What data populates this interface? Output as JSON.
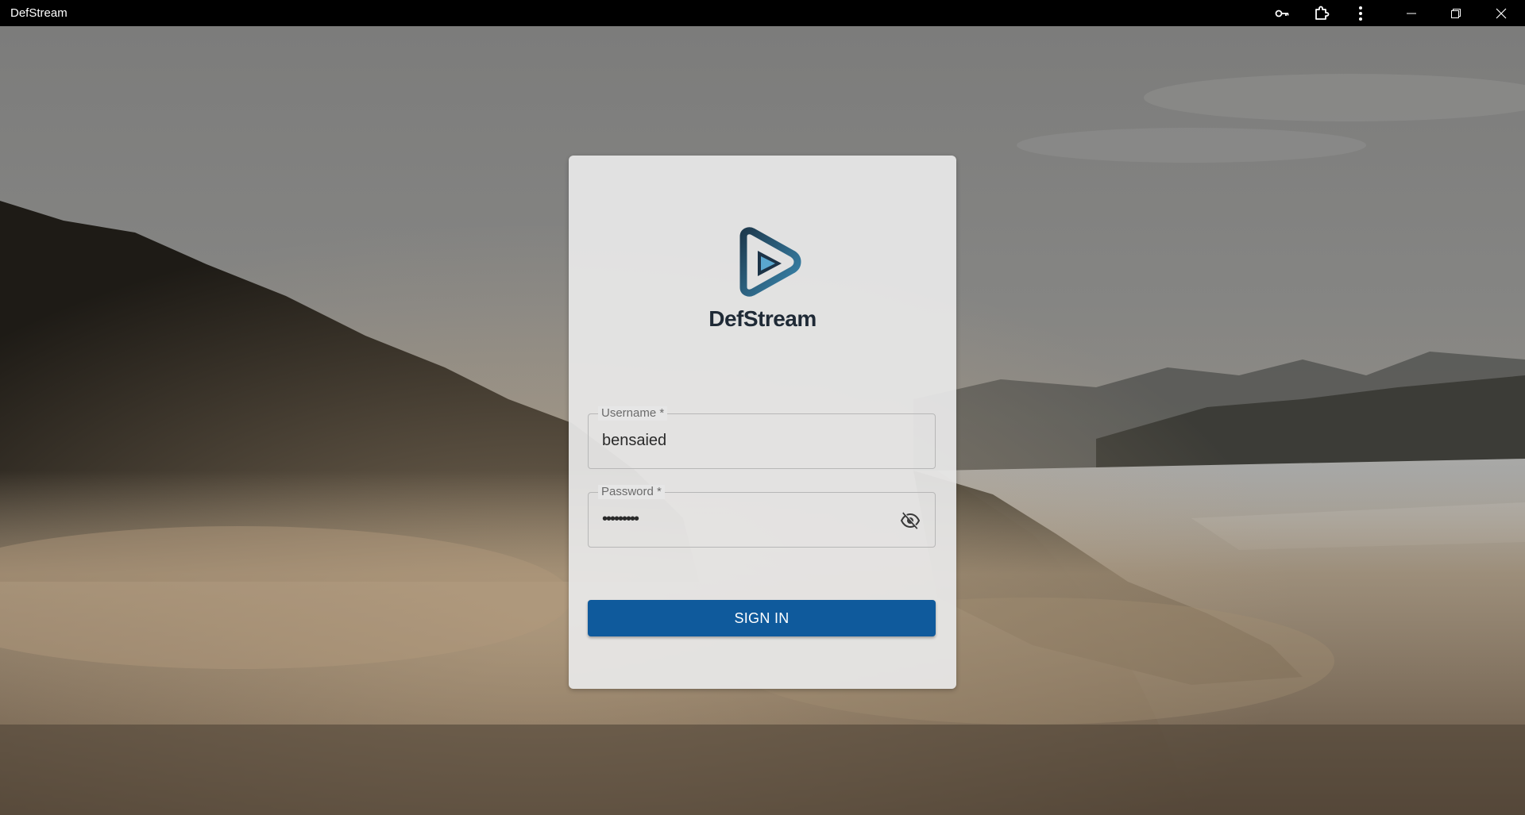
{
  "window": {
    "title": "DefStream",
    "controls": {
      "key_icon": "key-icon",
      "extension_icon": "puzzle-piece-icon",
      "menu_icon": "more-vertical-icon",
      "minimize_icon": "minimize-icon",
      "restore_icon": "restore-icon",
      "close_icon": "close-icon"
    }
  },
  "login": {
    "brand_name": "DefStream",
    "logo_icon": "play-triangle-logo-icon",
    "username": {
      "label": "Username *",
      "value": "bensaied"
    },
    "password": {
      "label": "Password *",
      "masked_value": "•••••••••",
      "visibility_icon": "eye-off-icon"
    },
    "submit_label": "SIGN IN"
  },
  "colors": {
    "title_bar": "#000000",
    "primary_button": "#0f5a9c",
    "brand_text": "#1f2a36",
    "logo_accent": "#3a88b0"
  }
}
